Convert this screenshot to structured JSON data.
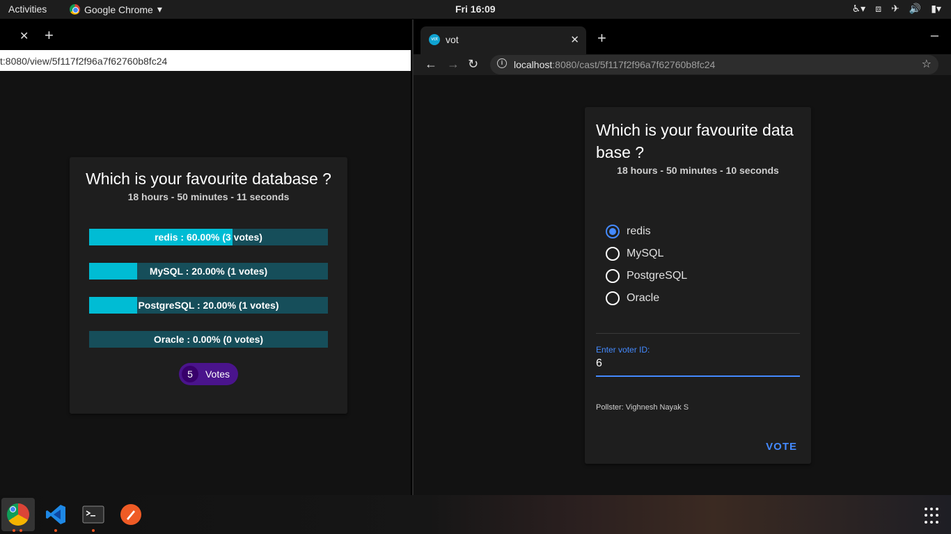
{
  "topbar": {
    "activities": "Activities",
    "app_name": "Google Chrome",
    "clock": "Fri 16:09"
  },
  "left_window": {
    "url": "t:8080/view/5f117f2f96a7f62760b8fc24",
    "question": "Which is your favourite database ?",
    "timer": "18 hours - 50 minutes - 11 seconds",
    "results": [
      {
        "label": "redis : 60.00% (3 votes)",
        "percent": 60
      },
      {
        "label": "MySQL : 20.00% (1 votes)",
        "percent": 20
      },
      {
        "label": "PostgreSQL : 20.00% (1 votes)",
        "percent": 20
      },
      {
        "label": "Oracle : 0.00% (0 votes)",
        "percent": 0
      }
    ],
    "total_votes": "5",
    "votes_label": "Votes"
  },
  "right_window": {
    "tab_title": "vot",
    "favicon_text": "vot",
    "url_host": "localhost",
    "url_rest": ":8080/cast/5f117f2f96a7f62760b8fc24",
    "question": "Which is your favourite database ?",
    "timer": "18 hours - 50 minutes - 10 seconds",
    "options": [
      "redis",
      "MySQL",
      "PostgreSQL",
      "Oracle"
    ],
    "selected_option": "redis",
    "voter_label": "Enter voter ID:",
    "voter_value": "6",
    "pollster": "Pollster: Vighnesh Nayak S",
    "vote_button": "VOTE"
  },
  "colors": {
    "accent": "#448aff",
    "bar_fill": "#00bcd4",
    "bar_bg": "#164e5a",
    "chip": "#4a148c"
  }
}
